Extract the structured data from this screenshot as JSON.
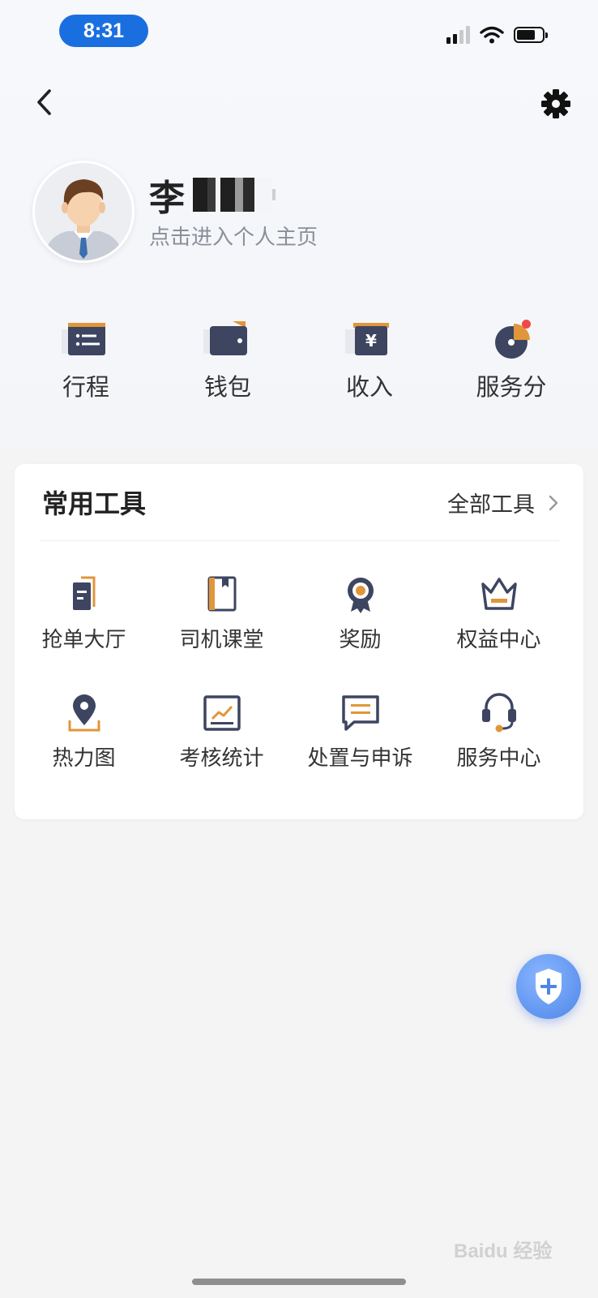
{
  "status_bar": {
    "time": "8:31"
  },
  "profile": {
    "name": "李",
    "subtitle": "点击进入个人主页"
  },
  "quick_entries": [
    {
      "label": "行程",
      "icon": "itinerary-icon"
    },
    {
      "label": "钱包",
      "icon": "wallet-icon"
    },
    {
      "label": "收入",
      "icon": "income-icon"
    },
    {
      "label": "服务分",
      "icon": "service-score-icon",
      "badge": "red-dot"
    }
  ],
  "tools": {
    "title": "常用工具",
    "all_label": "全部工具",
    "items": [
      {
        "label": "抢单大厅",
        "icon": "order-hall-icon"
      },
      {
        "label": "司机课堂",
        "icon": "driver-class-icon"
      },
      {
        "label": "奖励",
        "icon": "reward-medal-icon"
      },
      {
        "label": "权益中心",
        "icon": "crown-icon"
      },
      {
        "label": "热力图",
        "icon": "heatmap-pin-icon"
      },
      {
        "label": "考核统计",
        "icon": "stats-chart-icon"
      },
      {
        "label": "处置与申诉",
        "icon": "appeal-message-icon"
      },
      {
        "label": "服务中心",
        "icon": "headset-icon"
      }
    ]
  },
  "watermark": "Baidu 经验",
  "colors": {
    "navy": "#3d4560",
    "orange": "#e0963a",
    "accent_blue": "#1a6fe0",
    "badge_red": "#f04848"
  }
}
